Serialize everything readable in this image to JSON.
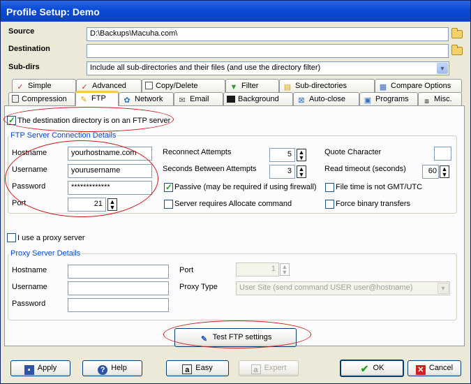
{
  "window": {
    "title": "Profile Setup: Demo"
  },
  "top": {
    "source_label": "Source",
    "source_value": "D:\\Backups\\Macuha.com\\",
    "destination_label": "Destination",
    "destination_value": "",
    "subdirs_label": "Sub-dirs",
    "subdirs_value": "Include all sub-directories and their files (and use the directory filter)"
  },
  "tabs_row1": [
    "Simple",
    "Advanced",
    "Copy/Delete",
    "Filter",
    "Sub-directories",
    "Compare Options"
  ],
  "tabs_row2": [
    "Compression",
    "FTP",
    "Network",
    "Email",
    "Background",
    "Auto-close",
    "Programs",
    "Misc."
  ],
  "ftp": {
    "ftp_checkbox_label": "The destination directory is on an FTP server",
    "group_title": "FTP Server Connection Details",
    "hostname_label": "Hostname",
    "hostname_value": "yourhostname.com",
    "username_label": "Username",
    "username_value": "yourusername",
    "password_label": "Password",
    "password_value": "*************",
    "port_label": "Port",
    "port_value": "21",
    "reconnect_label": "Reconnect Attempts",
    "reconnect_value": "5",
    "seconds_label": "Seconds Between Attempts",
    "seconds_value": "3",
    "passive_label": "Passive (may be required if using firewall)",
    "allocate_label": "Server requires Allocate command",
    "quote_label": "Quote Character",
    "quote_value": "",
    "read_timeout_label": "Read timeout (seconds)",
    "read_timeout_value": "60",
    "gmt_label": "File time is not GMT/UTC",
    "binary_label": "Force binary transfers"
  },
  "proxy": {
    "use_proxy_label": "I use a proxy server",
    "group_title": "Proxy Server Details",
    "hostname_label": "Hostname",
    "hostname_value": "",
    "username_label": "Username",
    "username_value": "",
    "password_label": "Password",
    "password_value": "",
    "port_label": "Port",
    "port_value": "1",
    "proxy_type_label": "Proxy Type",
    "proxy_type_value": "User Site (send command USER user@hostname)"
  },
  "test_button": "Test FTP settings",
  "buttons": {
    "apply": "Apply",
    "help": "Help",
    "easy": "Easy",
    "expert": "Expert",
    "ok": "OK",
    "cancel": "Cancel"
  }
}
